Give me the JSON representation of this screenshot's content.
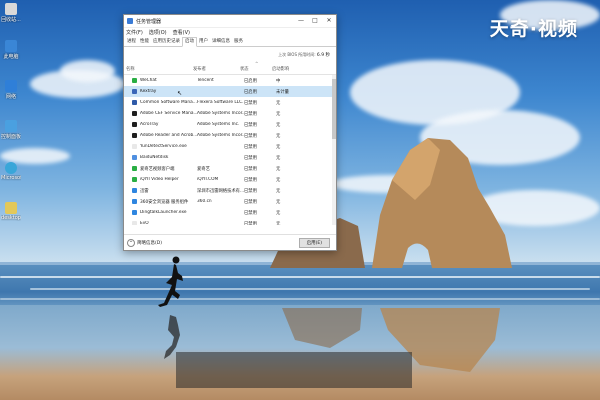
{
  "watermark": "天奇·视频",
  "desktop": {
    "icons": [
      {
        "label": "回收站...",
        "color": "#d9d9d9"
      },
      {
        "label": "此电脑",
        "color": "#3a86d6"
      },
      {
        "label": "网络",
        "color": "#2f7fd8"
      },
      {
        "label": "控制面板",
        "color": "#4aa0e0"
      },
      {
        "label": "Microsoft Edge",
        "color": "#39a6d9"
      },
      {
        "label": "desktop",
        "color": "#e2c85a"
      }
    ]
  },
  "window": {
    "title": "任务管理器",
    "controls": {
      "minimize": "—",
      "maximize": "□",
      "close": "✕"
    },
    "menu": [
      "文件(F)",
      "选项(O)",
      "查看(V)"
    ],
    "tabs": [
      "进程",
      "性能",
      "应用历史记录",
      "启动",
      "用户",
      "详细信息",
      "服务"
    ],
    "active_tab": "启动",
    "bios_label": "上次 BIOS 所用时间:",
    "bios_value": "6.9 秒",
    "columns": [
      "名称",
      "发布者",
      "状态",
      "启动影响"
    ],
    "rows": [
      {
        "name": "WeChat",
        "publisher": "Tencent",
        "status": "已启用",
        "impact": "中",
        "icon_color": "#2aae44"
      },
      {
        "name": "Kextray",
        "publisher": "",
        "status": "已启用",
        "impact": "未计量",
        "icon_color": "#3a66b8",
        "selected": true
      },
      {
        "name": "Common Software Mana...",
        "publisher": "Flexera Software LLC.",
        "status": "已禁用",
        "impact": "无",
        "icon_color": "#2f5aa8"
      },
      {
        "name": "Adobe CEF Service Mana...",
        "publisher": "Adobe Systems Incor...",
        "status": "已禁用",
        "impact": "无",
        "icon_color": "#1f1f1f"
      },
      {
        "name": "AcroTray",
        "publisher": "Adobe Systems Inc.",
        "status": "已禁用",
        "impact": "无",
        "icon_color": "#1f1f1f"
      },
      {
        "name": "Adobe Reader and Acrob...",
        "publisher": "Adobe Systems Incor...",
        "status": "已禁用",
        "impact": "无",
        "icon_color": "#1f1f1f"
      },
      {
        "name": "YunDetectService.exe",
        "publisher": "",
        "status": "已禁用",
        "impact": "无",
        "icon_color": "#e8e8e8"
      },
      {
        "name": "BaiduNetdisk",
        "publisher": "",
        "status": "已禁用",
        "impact": "无",
        "icon_color": "#4f8fe0"
      },
      {
        "name": "爱奇艺视频客户端",
        "publisher": "爱奇艺",
        "status": "已禁用",
        "impact": "无",
        "icon_color": "#2aae44"
      },
      {
        "name": "iQIYI Video Helper",
        "publisher": "iQIYI.COM",
        "status": "已禁用",
        "impact": "无",
        "icon_color": "#2aae44"
      },
      {
        "name": "迅雷",
        "publisher": "深圳市迅雷网络技术有...",
        "status": "已禁用",
        "impact": "无",
        "icon_color": "#2f86e0"
      },
      {
        "name": "360安全浏览器 服务组件",
        "publisher": "360.cn",
        "status": "已禁用",
        "impact": "无",
        "icon_color": "#2f86e0"
      },
      {
        "name": "DingtalkLauncher.exe",
        "publisher": "",
        "status": "已禁用",
        "impact": "无",
        "icon_color": "#2f86e0"
      },
      {
        "name": "EvO",
        "publisher": "",
        "status": "已禁用",
        "impact": "无",
        "icon_color": "#e8e8e8"
      }
    ],
    "footer_less": "简略信息(D)",
    "footer_button": "启用(E)"
  }
}
